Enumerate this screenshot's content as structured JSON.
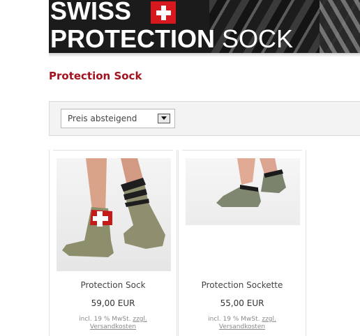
{
  "banner": {
    "line1": "SWISS",
    "line2_bold": "PROTECTION",
    "line2_thin": " SOCK"
  },
  "page": {
    "title": "Protection Sock"
  },
  "sort": {
    "selected": "Preis absteigend"
  },
  "products": [
    {
      "name": "Protection Sock",
      "price": "59,00 EUR",
      "tax_prefix": "incl. 19 % MwSt.",
      "tax_link1": "zzgl.",
      "tax_link2": "Versandkosten"
    },
    {
      "name": "Protection Sockette",
      "price": "55,00 EUR",
      "tax_prefix": "incl. 19 % MwSt.",
      "tax_link1": "zzgl.",
      "tax_link2": "Versandkosten"
    }
  ],
  "colors": {
    "title_red": "#a3121f",
    "swiss_red": "#d7181f"
  }
}
